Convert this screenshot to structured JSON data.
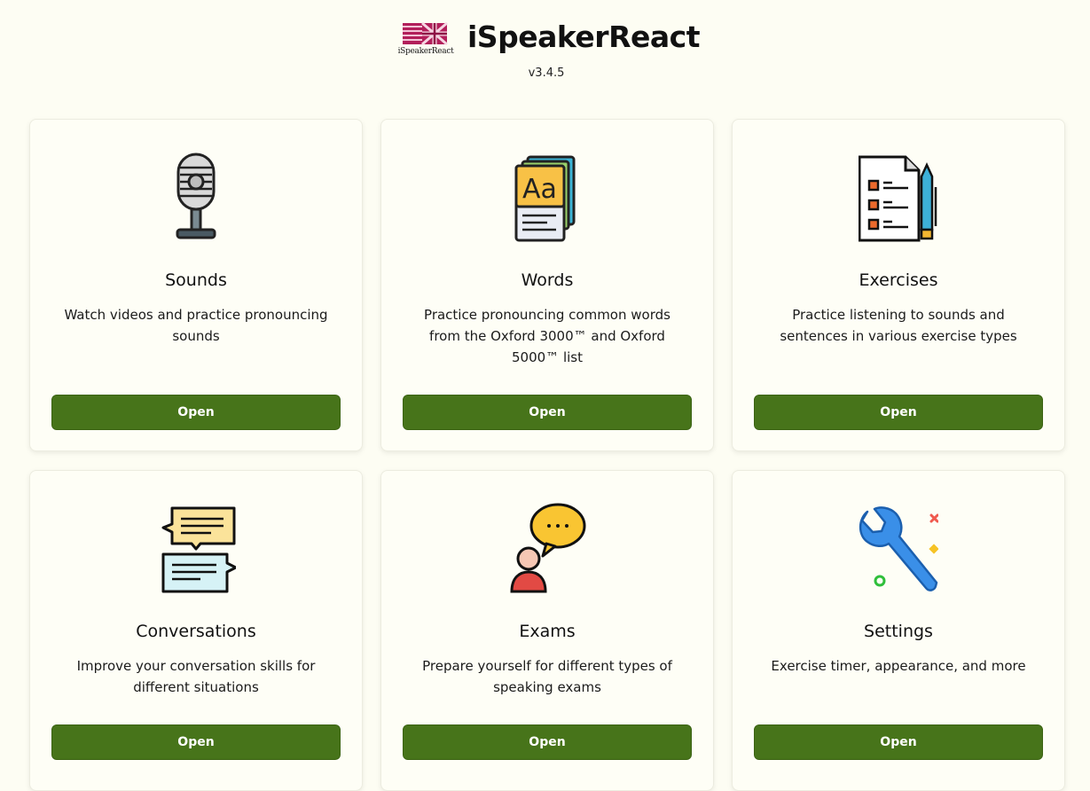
{
  "header": {
    "logo_text": "iSpeakerReact",
    "title": "iSpeakerReact",
    "version": "v3.4.5"
  },
  "cards": [
    {
      "title": "Sounds",
      "description": "Watch videos and practice pronouncing sounds",
      "button": "Open",
      "icon": "microphone-icon"
    },
    {
      "title": "Words",
      "description": "Practice pronouncing common words from the Oxford 3000™ and Oxford 5000™ list",
      "button": "Open",
      "icon": "flashcards-icon"
    },
    {
      "title": "Exercises",
      "description": "Practice listening to sounds and sentences in various exercise types",
      "button": "Open",
      "icon": "checklist-pencil-icon"
    },
    {
      "title": "Conversations",
      "description": "Improve your conversation skills for different situations",
      "button": "Open",
      "icon": "chat-bubbles-icon"
    },
    {
      "title": "Exams",
      "description": "Prepare yourself for different types of speaking exams",
      "button": "Open",
      "icon": "speaker-bubble-icon"
    },
    {
      "title": "Settings",
      "description": "Exercise timer, appearance, and more",
      "button": "Open",
      "icon": "wrench-icon"
    }
  ],
  "colors": {
    "background": "#fdfdf3",
    "button": "#47741a",
    "button_text": "#ffffff"
  }
}
